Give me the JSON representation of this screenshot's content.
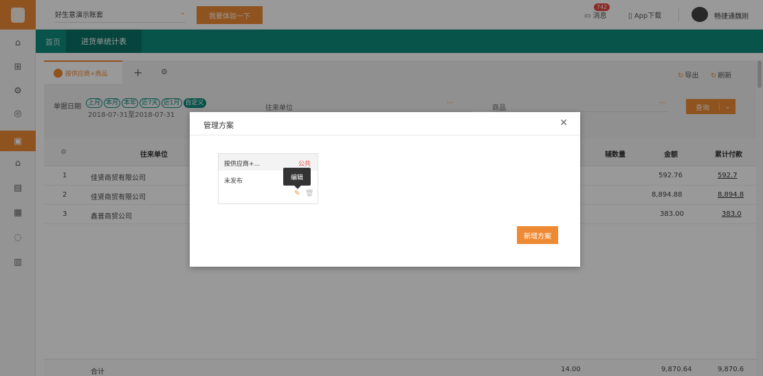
{
  "header": {
    "account": "好生意演示账套",
    "try_button": "我要体验一下",
    "messages_label": "消息",
    "messages_badge": "742",
    "app_download": "App下载",
    "user_name": "畅捷通魏刚"
  },
  "nav": {
    "home": "首页",
    "active_tab": "进货单统计表"
  },
  "toolbar": {
    "scheme_tab": "按供应商+商品",
    "export": "导出",
    "refresh": "刷新"
  },
  "filters": {
    "date_label": "单据日期",
    "chips": [
      "上月",
      "本月",
      "本年",
      "近7天",
      "近1月",
      "自定义"
    ],
    "date_range": "2018-07-31至2018-07-31",
    "partner_label": "往来单位",
    "goods_label": "商品",
    "query_button": "查询"
  },
  "table": {
    "headers": {
      "partner": "往来单位",
      "aux_qty": "辅数量",
      "amount": "金额",
      "cum_paid": "累计付款"
    },
    "rows": [
      {
        "idx": "1",
        "partner": "佳贤商贸有限公司",
        "amount": "592.76",
        "paid": "592.7"
      },
      {
        "idx": "2",
        "partner": "佳贤商贸有限公司",
        "amount": "8,894.88",
        "paid": "8,894.8"
      },
      {
        "idx": "3",
        "partner": "鑫普商贸公司",
        "amount": "383.00",
        "paid": "383.0"
      }
    ],
    "total": {
      "label": "合计",
      "qty": "14.00",
      "amount": "9,870.64",
      "paid": "9,870.6"
    }
  },
  "modal": {
    "title": "管理方案",
    "card_name": "按供应商+...",
    "card_public": "公共",
    "card_status": "未发布",
    "tooltip": "编辑",
    "add_button": "新增方案"
  },
  "colors": {
    "accent": "#ef8a34",
    "nav": "#0e8a7c",
    "danger": "#e8453c"
  }
}
